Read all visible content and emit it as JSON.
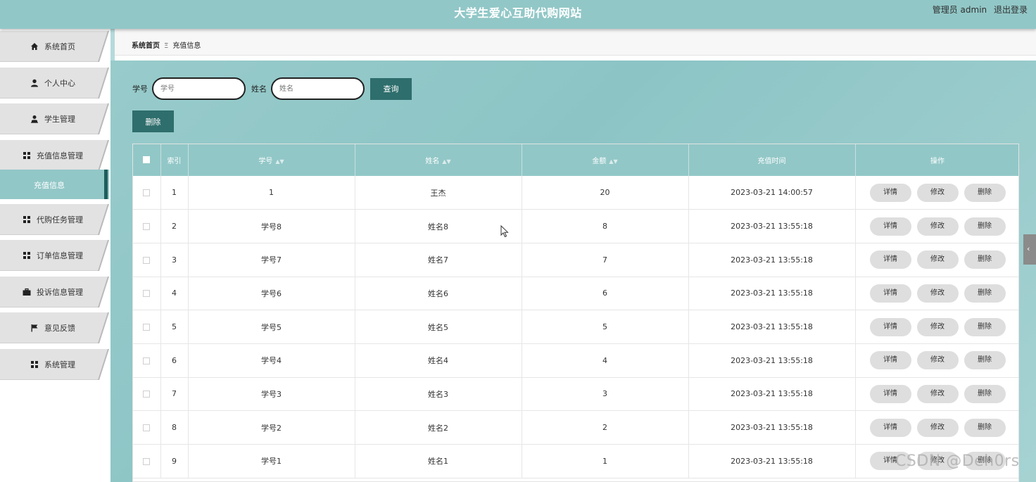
{
  "header": {
    "title": "大学生爱心互助代购网站",
    "role_user": "管理员 admin",
    "logout": "退出登录"
  },
  "sidebar": {
    "items": [
      {
        "label": "系统首页",
        "icon": "home-icon"
      },
      {
        "label": "个人中心",
        "icon": "user-icon"
      },
      {
        "label": "学生管理",
        "icon": "student-icon"
      },
      {
        "label": "充值信息管理",
        "icon": "grid-icon"
      },
      {
        "label": "代购任务管理",
        "icon": "grid-icon"
      },
      {
        "label": "订单信息管理",
        "icon": "grid-icon"
      },
      {
        "label": "投诉信息管理",
        "icon": "briefcase-icon"
      },
      {
        "label": "意见反馈",
        "icon": "flag-icon"
      },
      {
        "label": "系统管理",
        "icon": "grid-icon"
      }
    ],
    "active_sub": "充值信息"
  },
  "breadcrumb": {
    "home": "系统首页",
    "separator": "Ξ",
    "current": "充值信息"
  },
  "search": {
    "student_id_label": "学号",
    "student_id_placeholder": "学号",
    "name_label": "姓名",
    "name_placeholder": "姓名",
    "query_button": "查询"
  },
  "delete_button": "删除",
  "table": {
    "headers": {
      "index": "索引",
      "student_id": "学号",
      "name": "姓名",
      "amount": "金额",
      "time": "充值时间",
      "ops": "操作"
    },
    "op_labels": {
      "detail": "详情",
      "edit": "修改",
      "delete": "删除"
    },
    "rows": [
      {
        "index": "1",
        "student_id": "1",
        "name": "王杰",
        "amount": "20",
        "time": "2023-03-21 14:00:57"
      },
      {
        "index": "2",
        "student_id": "学号8",
        "name": "姓名8",
        "amount": "8",
        "time": "2023-03-21 13:55:18"
      },
      {
        "index": "3",
        "student_id": "学号7",
        "name": "姓名7",
        "amount": "7",
        "time": "2023-03-21 13:55:18"
      },
      {
        "index": "4",
        "student_id": "学号6",
        "name": "姓名6",
        "amount": "6",
        "time": "2023-03-21 13:55:18"
      },
      {
        "index": "5",
        "student_id": "学号5",
        "name": "姓名5",
        "amount": "5",
        "time": "2023-03-21 13:55:18"
      },
      {
        "index": "6",
        "student_id": "学号4",
        "name": "姓名4",
        "amount": "4",
        "time": "2023-03-21 13:55:18"
      },
      {
        "index": "7",
        "student_id": "学号3",
        "name": "姓名3",
        "amount": "3",
        "time": "2023-03-21 13:55:18"
      },
      {
        "index": "8",
        "student_id": "学号2",
        "name": "姓名2",
        "amount": "2",
        "time": "2023-03-21 13:55:18"
      },
      {
        "index": "9",
        "student_id": "学号1",
        "name": "姓名1",
        "amount": "1",
        "time": "2023-03-21 13:55:18"
      }
    ]
  },
  "watermark": "CSDN @Deh0rs",
  "colors": {
    "header_bg": "#92c7c7",
    "accent_dark": "#2e6e6c",
    "sidebar_item_bg": "#e2e2e2"
  }
}
